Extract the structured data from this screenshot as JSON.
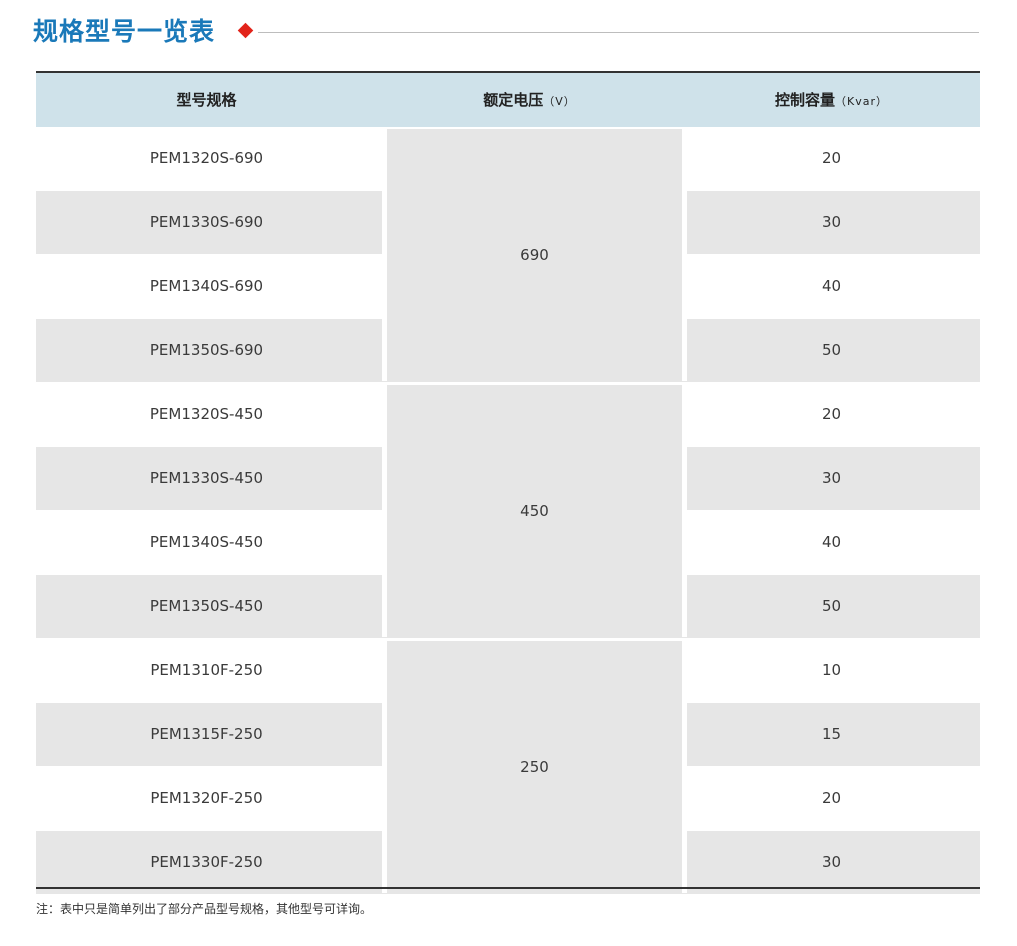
{
  "title": "规格型号一览表",
  "table": {
    "headers": {
      "model": "型号规格",
      "voltage": "额定电压",
      "voltage_unit": "（V）",
      "capacity": "控制容量",
      "capacity_unit": "（Kvar）"
    },
    "groups": [
      {
        "voltage": "690",
        "rows": [
          {
            "model": "PEM1320S-690",
            "capacity": "20"
          },
          {
            "model": "PEM1330S-690",
            "capacity": "30"
          },
          {
            "model": "PEM1340S-690",
            "capacity": "40"
          },
          {
            "model": "PEM1350S-690",
            "capacity": "50"
          }
        ]
      },
      {
        "voltage": "450",
        "rows": [
          {
            "model": "PEM1320S-450",
            "capacity": "20"
          },
          {
            "model": "PEM1330S-450",
            "capacity": "30"
          },
          {
            "model": "PEM1340S-450",
            "capacity": "40"
          },
          {
            "model": "PEM1350S-450",
            "capacity": "50"
          }
        ]
      },
      {
        "voltage": "250",
        "rows": [
          {
            "model": "PEM1310F-250",
            "capacity": "10"
          },
          {
            "model": "PEM1315F-250",
            "capacity": "15"
          },
          {
            "model": "PEM1320F-250",
            "capacity": "20"
          },
          {
            "model": "PEM1330F-250",
            "capacity": "30"
          }
        ]
      }
    ]
  },
  "note": "注：表中只是简单列出了部分产品型号规格，其他型号可详询。",
  "colors": {
    "title": "#1a79b9",
    "diamond": "#e2231a",
    "header_bg": "#cfe2ea",
    "band_bg": "#e6e6e6"
  }
}
